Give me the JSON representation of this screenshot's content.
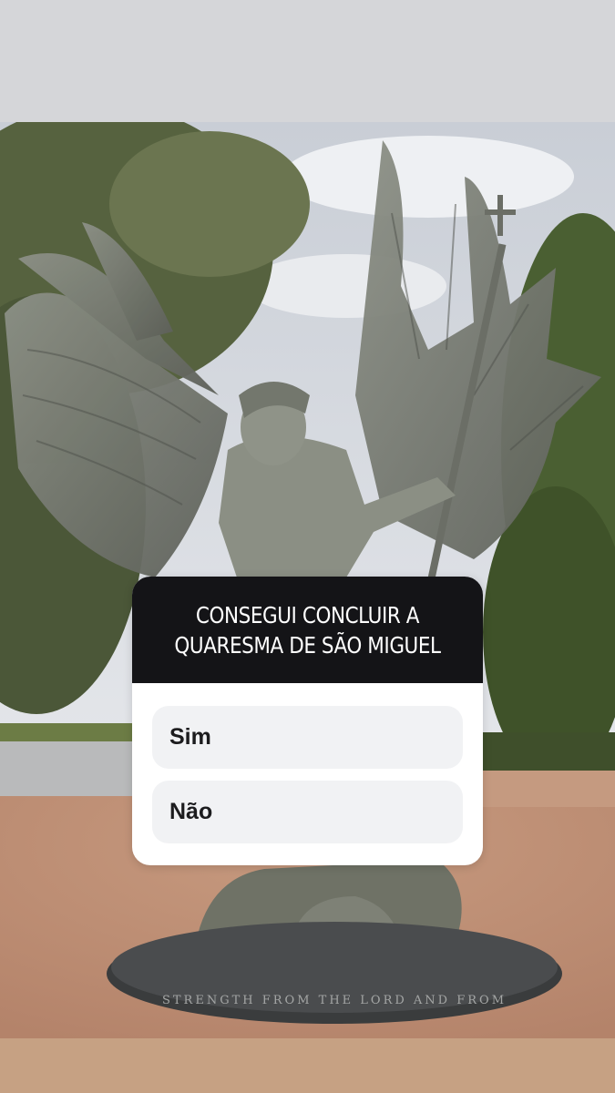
{
  "poll": {
    "question": "CONSEGUI CONCLUIR A\nQUARESMA DE SÃO MIGUEL",
    "options": [
      {
        "label": "Sim"
      },
      {
        "label": "Não"
      }
    ]
  },
  "photo": {
    "subject": "statue of Saint Michael the Archangel with spread wings",
    "inscription": "...STRENGTH FROM THE LORD AND FROM..."
  },
  "colors": {
    "top_band": "#d5d6d9",
    "bottom_band": "#c6a183",
    "poll_header": "#141417",
    "poll_option_bg": "#f1f2f4"
  }
}
